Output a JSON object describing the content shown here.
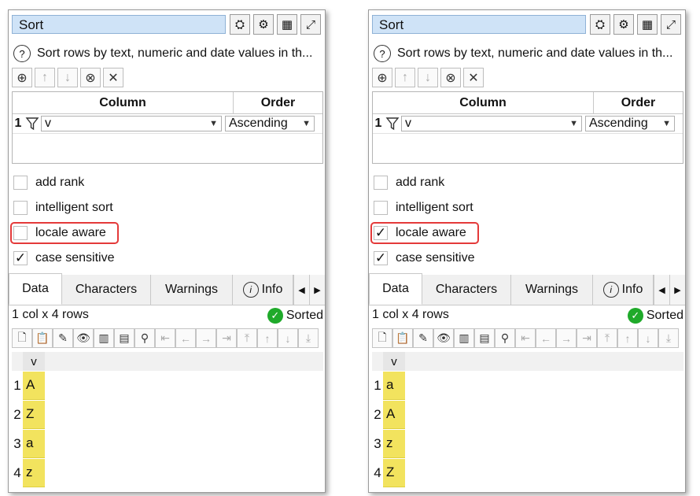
{
  "panels": [
    {
      "title": "Sort",
      "description": "Sort rows by text, numeric and date values in th...",
      "sort_table": {
        "col_header": "Column",
        "order_header": "Order",
        "rows": [
          {
            "num": "1",
            "column": "v",
            "order": "Ascending"
          }
        ]
      },
      "checkboxes": [
        {
          "label": "add rank",
          "checked": false,
          "mark": ""
        },
        {
          "label": "intelligent sort",
          "checked": false,
          "mark": ""
        },
        {
          "label": "locale aware",
          "checked": false,
          "mark": ""
        },
        {
          "label": "case sensitive",
          "checked": true,
          "mark": "✓"
        }
      ],
      "tabs": [
        "Data",
        "Characters",
        "Warnings",
        "Info"
      ],
      "status": {
        "rows": "1 col x 4 rows",
        "sorted": "Sorted"
      },
      "grid": {
        "header": "v",
        "rows": [
          {
            "num": "1",
            "value": "A"
          },
          {
            "num": "2",
            "value": "Z"
          },
          {
            "num": "3",
            "value": "a"
          },
          {
            "num": "4",
            "value": "z"
          }
        ]
      }
    },
    {
      "title": "Sort",
      "description": "Sort rows by text, numeric and date values in th...",
      "sort_table": {
        "col_header": "Column",
        "order_header": "Order",
        "rows": [
          {
            "num": "1",
            "column": "v",
            "order": "Ascending"
          }
        ]
      },
      "checkboxes": [
        {
          "label": "add rank",
          "checked": false,
          "mark": ""
        },
        {
          "label": "intelligent sort",
          "checked": false,
          "mark": ""
        },
        {
          "label": "locale aware",
          "checked": true,
          "mark": "✓"
        },
        {
          "label": "case sensitive",
          "checked": true,
          "mark": "✓"
        }
      ],
      "tabs": [
        "Data",
        "Characters",
        "Warnings",
        "Info"
      ],
      "status": {
        "rows": "1 col x 4 rows",
        "sorted": "Sorted"
      },
      "grid": {
        "header": "v",
        "rows": [
          {
            "num": "1",
            "value": "a"
          },
          {
            "num": "2",
            "value": "A"
          },
          {
            "num": "3",
            "value": "z"
          },
          {
            "num": "4",
            "value": "Z"
          }
        ]
      }
    }
  ],
  "colors": {
    "highlight": "#e43a3a",
    "cell": "#f2e35e",
    "sorted_ok": "#1faa2a",
    "title_bg": "#cfe3f7"
  },
  "icons": [
    "node-icon",
    "gear-icon",
    "table-icon",
    "expand-icon",
    "help-icon",
    "add-icon",
    "up-arrow-icon",
    "down-arrow-icon",
    "remove-icon",
    "close-icon",
    "filter-icon",
    "dropdown-arrow-icon",
    "check-icon",
    "info-icon"
  ]
}
